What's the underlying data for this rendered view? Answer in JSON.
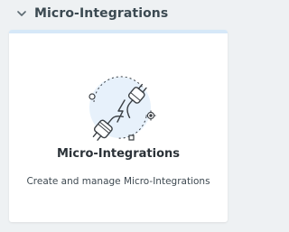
{
  "section": {
    "title": "Micro-Integrations",
    "chevron_icon": "chevron-down-icon"
  },
  "card": {
    "title": "Micro-Integrations",
    "description": "Create and manage Micro-Integrations",
    "illustration_icon": "plug-connection-icon"
  },
  "colors": {
    "page_background": "#eef1f3",
    "card_background": "#ffffff",
    "card_topbar": "#d6e8f8",
    "illustration_circle": "#e7f1fb",
    "heading_text": "#3c4a52"
  }
}
